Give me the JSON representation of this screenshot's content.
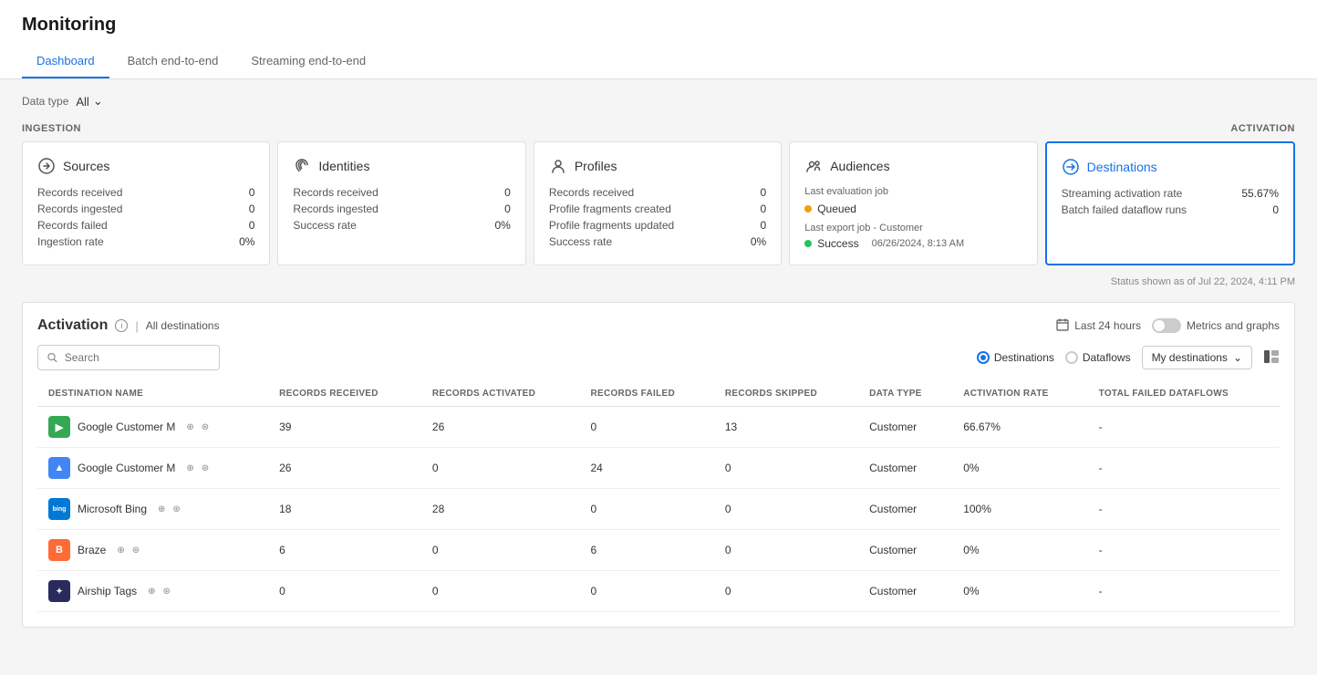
{
  "page": {
    "title": "Monitoring"
  },
  "tabs": [
    {
      "id": "dashboard",
      "label": "Dashboard",
      "active": true
    },
    {
      "id": "batch",
      "label": "Batch end-to-end",
      "active": false
    },
    {
      "id": "streaming",
      "label": "Streaming end-to-end",
      "active": false
    }
  ],
  "data_type": {
    "label": "Data type",
    "value": "All"
  },
  "ingestion_label": "INGESTION",
  "activation_label": "ACTIVATION",
  "cards": {
    "sources": {
      "title": "Sources",
      "icon": "arrow-right-circle",
      "rows": [
        {
          "label": "Records received",
          "value": "0"
        },
        {
          "label": "Records ingested",
          "value": "0"
        },
        {
          "label": "Records failed",
          "value": "0"
        },
        {
          "label": "Ingestion rate",
          "value": "0%"
        }
      ]
    },
    "identities": {
      "title": "Identities",
      "icon": "fingerprint",
      "rows": [
        {
          "label": "Records received",
          "value": "0"
        },
        {
          "label": "Records ingested",
          "value": "0"
        },
        {
          "label": "Success rate",
          "value": "0%"
        }
      ]
    },
    "profiles": {
      "title": "Profiles",
      "icon": "person",
      "rows": [
        {
          "label": "Records received",
          "value": "0"
        },
        {
          "label": "Profile fragments created",
          "value": "0"
        },
        {
          "label": "Profile fragments updated",
          "value": "0"
        },
        {
          "label": "Success rate",
          "value": "0%"
        }
      ]
    },
    "audiences": {
      "title": "Audiences",
      "icon": "audiences",
      "last_eval": "Last evaluation job",
      "queued": "Queued",
      "last_export": "Last export job - Customer",
      "success": "Success",
      "success_date": "06/26/2024, 8:13 AM"
    },
    "destinations": {
      "title": "Destinations",
      "icon": "destinations",
      "rows": [
        {
          "label": "Streaming activation rate",
          "value": "55.67%"
        },
        {
          "label": "Batch failed dataflow runs",
          "value": "0"
        }
      ]
    }
  },
  "status_shown": "Status shown as of Jul 22, 2024, 4:11 PM",
  "activation": {
    "title": "Activation",
    "all_destinations": "All destinations",
    "last_hours": "Last 24 hours",
    "metrics_graphs": "Metrics and graphs",
    "search_placeholder": "Search",
    "destinations_radio": "Destinations",
    "dataflows_radio": "Dataflows",
    "dropdown_label": "My destinations",
    "columns": [
      "DESTINATION NAME",
      "RECORDS RECEIVED",
      "RECORDS ACTIVATED",
      "RECORDS FAILED",
      "RECORDS SKIPPED",
      "DATA TYPE",
      "ACTIVATION RATE",
      "TOTAL FAILED DATAFLOWS"
    ],
    "rows": [
      {
        "name": "Google Customer M",
        "logo_type": "green",
        "logo_letter": "▶",
        "records_received": "39",
        "records_activated": "26",
        "records_failed": "0",
        "records_skipped": "13",
        "data_type": "Customer",
        "activation_rate": "66.67%",
        "total_failed": "-"
      },
      {
        "name": "Google Customer M",
        "logo_type": "blue",
        "logo_letter": "▲",
        "records_received": "26",
        "records_activated": "0",
        "records_failed": "24",
        "records_skipped": "0",
        "data_type": "Customer",
        "activation_rate": "0%",
        "total_failed": "-"
      },
      {
        "name": "Microsoft Bing",
        "logo_type": "bing",
        "logo_letter": "b",
        "records_received": "18",
        "records_activated": "28",
        "records_failed": "0",
        "records_skipped": "0",
        "data_type": "Customer",
        "activation_rate": "100%",
        "total_failed": "-"
      },
      {
        "name": "Braze",
        "logo_type": "braze",
        "logo_letter": "B",
        "records_received": "6",
        "records_activated": "0",
        "records_failed": "6",
        "records_skipped": "0",
        "data_type": "Customer",
        "activation_rate": "0%",
        "total_failed": "-"
      },
      {
        "name": "Airship Tags",
        "logo_type": "airship",
        "logo_letter": "✈",
        "records_received": "0",
        "records_activated": "0",
        "records_failed": "0",
        "records_skipped": "0",
        "data_type": "Customer",
        "activation_rate": "0%",
        "total_failed": "-"
      }
    ]
  }
}
